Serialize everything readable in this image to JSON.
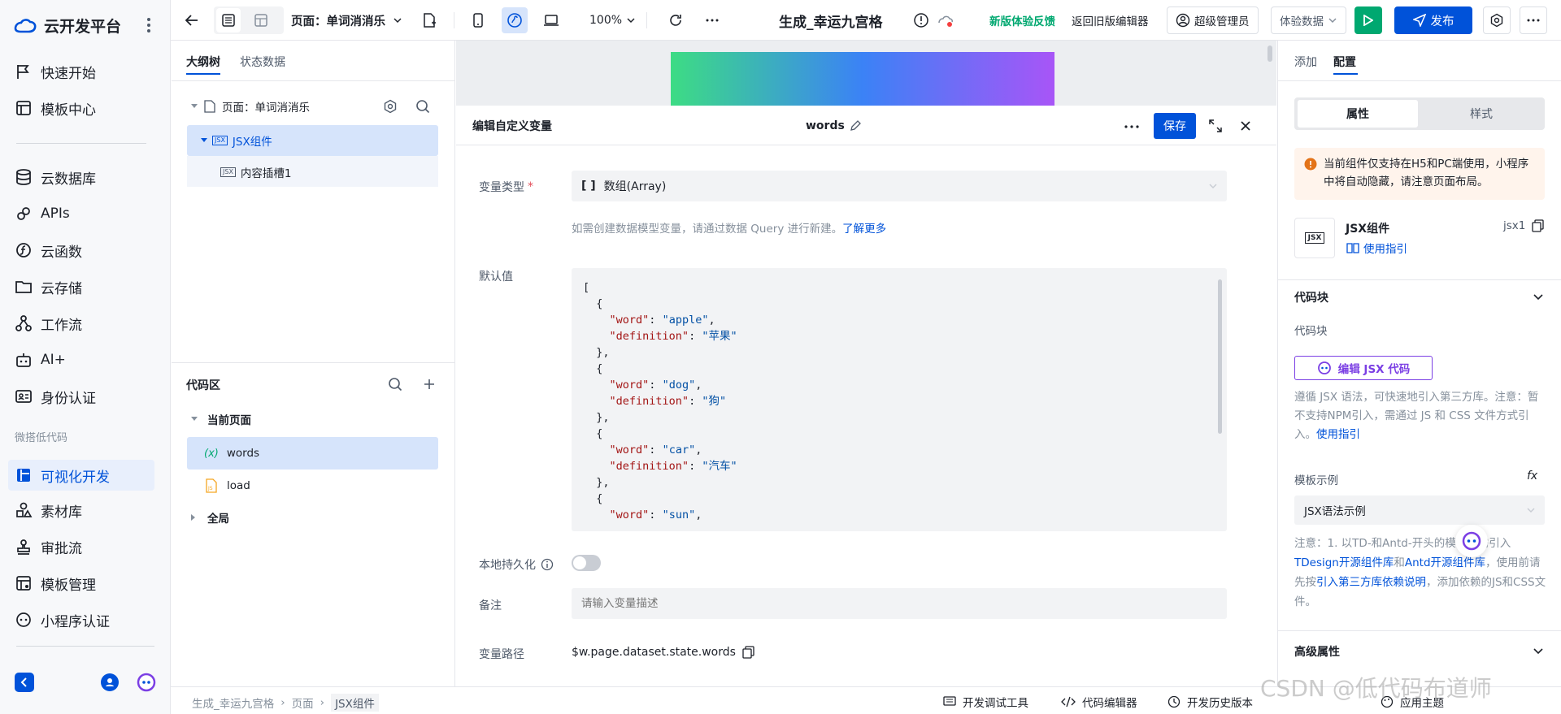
{
  "sidebar": {
    "brand": "云开发平台",
    "items": [
      {
        "label": "快速开始",
        "icon": "flag-icon"
      },
      {
        "label": "模板中心",
        "icon": "template-icon"
      },
      {
        "label": "云数据库",
        "icon": "database-icon"
      },
      {
        "label": "APIs",
        "icon": "api-icon"
      },
      {
        "label": "云函数",
        "icon": "function-icon"
      },
      {
        "label": "云存储",
        "icon": "folder-icon"
      },
      {
        "label": "工作流",
        "icon": "workflow-icon"
      },
      {
        "label": "AI+",
        "icon": "robot-icon"
      },
      {
        "label": "身份认证",
        "icon": "id-card-icon"
      }
    ],
    "section": "微搭低代码",
    "items2": [
      {
        "label": "可视化开发",
        "icon": "layout-icon"
      },
      {
        "label": "素材库",
        "icon": "shapes-icon"
      },
      {
        "label": "审批流",
        "icon": "stamp-icon"
      },
      {
        "label": "模板管理",
        "icon": "template-manage-icon"
      },
      {
        "label": "小程序认证",
        "icon": "miniprogram-icon"
      }
    ]
  },
  "topbar": {
    "page_select": "页面：单词消消乐",
    "zoom": "100%",
    "app_title": "生成_幸运九宫格",
    "feedback": "新版体验反馈",
    "old_editor": "返回旧版编辑器",
    "admin": "超级管理员",
    "data_mode": "体验数据",
    "publish": "发布"
  },
  "left_panel": {
    "tabs": [
      "大纲树",
      "状态数据"
    ],
    "page_node": "页面：单词消消乐",
    "jsx_node": "JSX组件",
    "slot_node": "内容插槽1",
    "code_title": "代码区",
    "current_page": "当前页面",
    "words": "words",
    "load": "load",
    "global": "全局"
  },
  "dialog": {
    "title": "编辑自定义变量",
    "var_name": "words",
    "save": "保存",
    "type_label": "变量类型",
    "type_value": "数组(Array)",
    "hint": "如需创建数据模型变量，请通过数据 Query 进行新建。",
    "hint_link": "了解更多",
    "default_label": "默认值",
    "persist_label": "本地持久化",
    "note_label": "备注",
    "note_placeholder": "请输入变量描述",
    "path_label": "变量路径",
    "path_value": "$w.page.dataset.state.words",
    "code_lines": [
      {
        "t": "["
      },
      {
        "t": "  {"
      },
      {
        "k": "\"word\"",
        "v": "\"apple\"",
        "i": "    ",
        "c": ","
      },
      {
        "k": "\"definition\"",
        "v": "\"苹果\"",
        "i": "    ",
        "c": ""
      },
      {
        "t": "  },"
      },
      {
        "t": "  {"
      },
      {
        "k": "\"word\"",
        "v": "\"dog\"",
        "i": "    ",
        "c": ","
      },
      {
        "k": "\"definition\"",
        "v": "\"狗\"",
        "i": "    ",
        "c": ""
      },
      {
        "t": "  },"
      },
      {
        "t": "  {"
      },
      {
        "k": "\"word\"",
        "v": "\"car\"",
        "i": "    ",
        "c": ","
      },
      {
        "k": "\"definition\"",
        "v": "\"汽车\"",
        "i": "    ",
        "c": ""
      },
      {
        "t": "  },"
      },
      {
        "t": "  {"
      },
      {
        "k": "\"word\"",
        "v": "\"sun\"",
        "i": "    ",
        "c": ","
      }
    ]
  },
  "right_panel": {
    "tabs": [
      "添加",
      "配置"
    ],
    "seg": [
      "属性",
      "样式"
    ],
    "warning": "当前组件仅支持在H5和PC端使用，小程序中将自动隐藏，请注意页面布局。",
    "comp_name": "JSX组件",
    "comp_id": "jsx1",
    "guide": "使用指引",
    "code_section": "代码块",
    "code_label": "代码块",
    "edit_jsx": "编辑 JSX 代码",
    "desc": "遵循 JSX 语法，可快速地引入第三方库。注意：暂不支持NPM引入，需通过 JS 和 CSS 文件方式引入。",
    "desc_link": "使用指引",
    "template_label": "模板示例",
    "template_value": "JSX语法示例",
    "note_a": "注意：1. 以TD-和Antd-开头的模板，需引入",
    "note_l1": "TDesign开源组件库",
    "note_b": "和",
    "note_l2": "Antd开源组件库",
    "note_c": "，使用前请先按",
    "note_l3": "引入第三方库依赖说明",
    "note_d": "，添加依赖的JS和CSS文件。",
    "advanced": "高级属性"
  },
  "bottom": {
    "crumbs": [
      "生成_幸运九宫格",
      "页面",
      "JSX组件"
    ],
    "debug": "开发调试工具",
    "code_editor": "代码编辑器",
    "history": "开发历史版本",
    "theme": "应用主题"
  },
  "watermark": "CSDN @低代码布道师",
  "colors": {
    "primary": "#0052d9",
    "publish_green": "#00a870",
    "active_bg": "#d6e4fb",
    "warning_bg": "#fff4ec",
    "warning": "#e37318"
  }
}
